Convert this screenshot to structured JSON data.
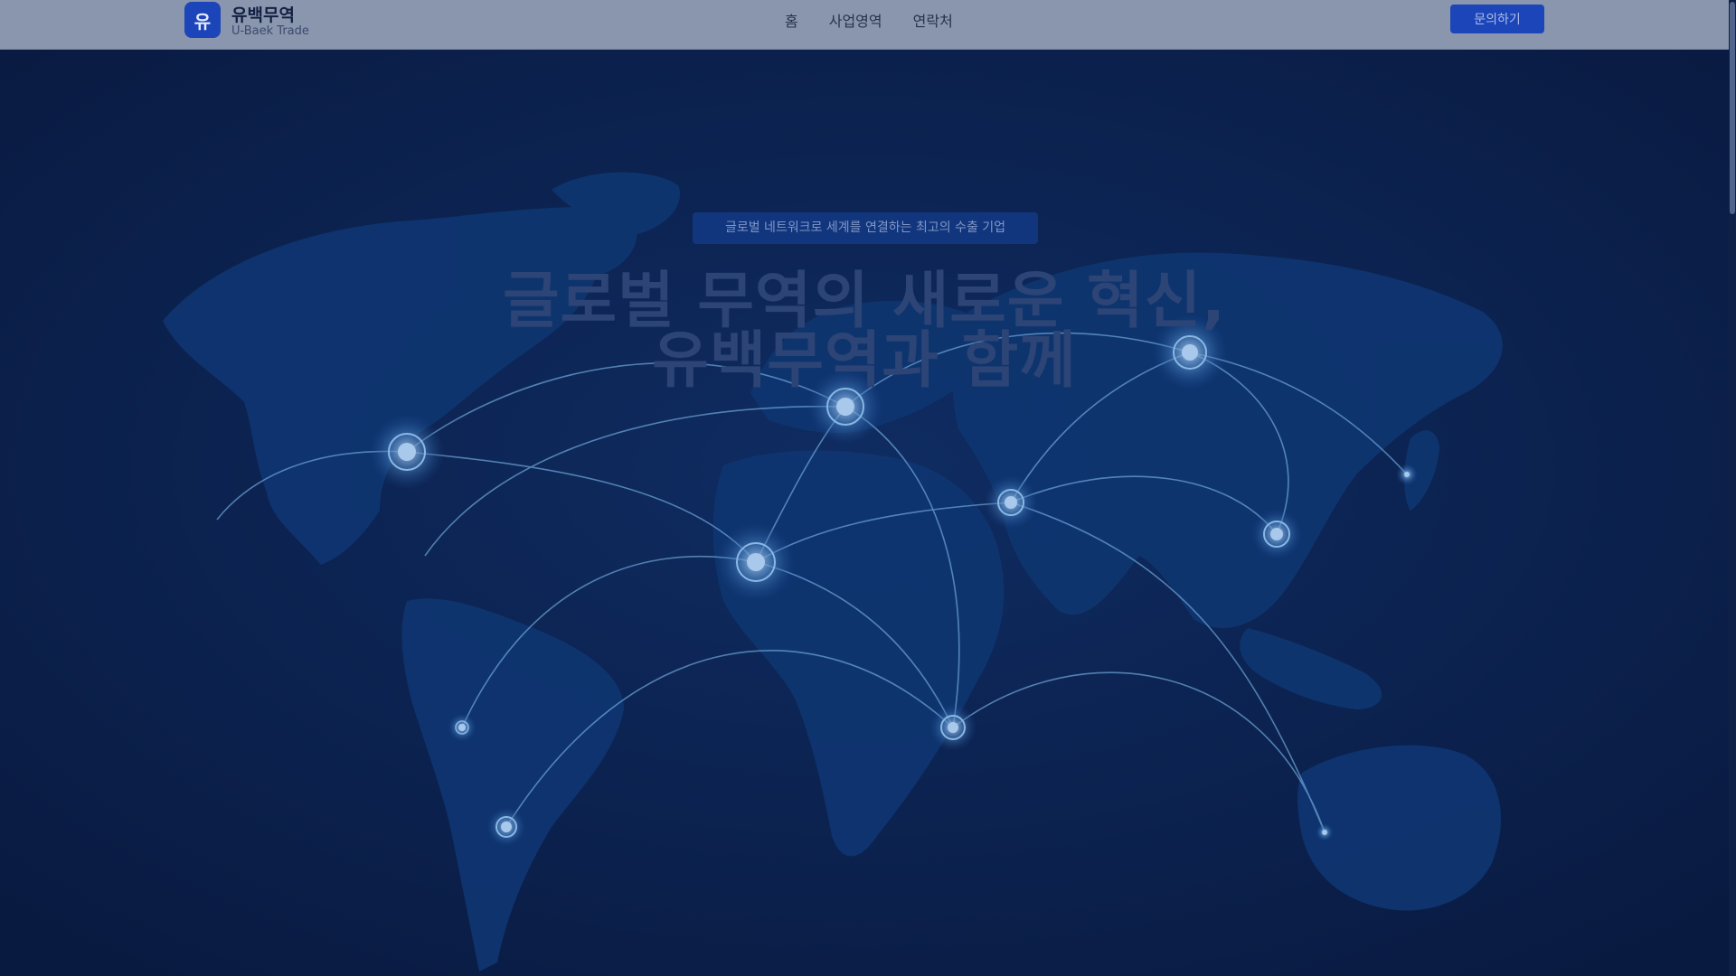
{
  "header": {
    "logo_glyph": "유",
    "brand_name": "유백무역",
    "brand_sub": "U-Baek Trade",
    "nav": [
      "홈",
      "사업영역",
      "연락처"
    ],
    "cta_label": "문의하기"
  },
  "hero": {
    "badge": "글로벌 네트워크로 세계를 연결하는 최고의 수출 기업",
    "title_line1": "글로벌 무역의 새로운 혁신,",
    "title_line2": "유백무역과 함께"
  },
  "colors": {
    "background": "#0b1f4a",
    "header": "#8a96ad",
    "accent": "#1b45b9",
    "continent": "#0f3570",
    "route": "#6fa7d8"
  },
  "icons": {
    "logo": "logo-badge-icon",
    "hub": "network-hub-icon"
  }
}
